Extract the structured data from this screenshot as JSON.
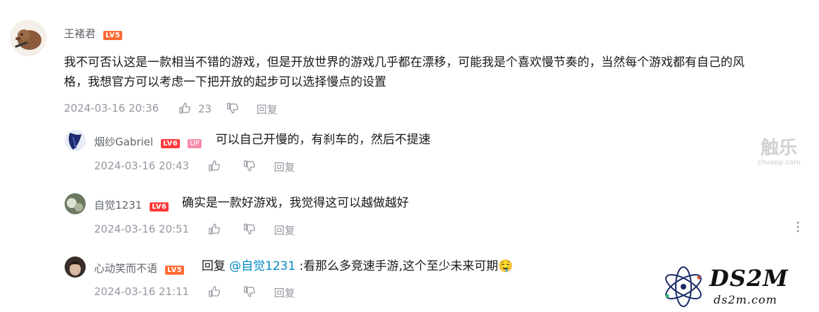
{
  "main_comment": {
    "username": "王褚君",
    "level": "LV5",
    "content": "我不可否认这是一款相当不错的游戏，但是开放世界的游戏几乎都在漂移，可能我是个喜欢慢节奏的，当然每个游戏都有自己的风格，我想官方可以考虑一下把开放的起步可以选择慢点的设置",
    "timestamp": "2024-03-16 20:36",
    "likes": "23",
    "reply_label": "回复"
  },
  "replies": [
    {
      "username": "烟纱Gabriel",
      "level": "LV6",
      "badge": "UP",
      "content": "可以自己开慢的，有刹车的，然后不提速",
      "timestamp": "2024-03-16 20:43",
      "reply_label": "回复"
    },
    {
      "username": "自觉1231",
      "level": "LV6",
      "content": "确实是一款好游戏，我觉得这可以越做越好",
      "timestamp": "2024-03-16 20:51",
      "reply_label": "回复"
    },
    {
      "username": "心动笑而不语",
      "level": "LV5",
      "reply_prefix": "回复",
      "mention": "@自觉1231",
      "content": ":看那么多竞速手游,这个至少未来可期",
      "emoji": "🤤",
      "timestamp": "2024-03-16 21:11",
      "reply_label": "回复"
    }
  ],
  "watermarks": {
    "chuapp_cn": "触乐",
    "chuapp_url": "chuapp.com",
    "ds2m_logo": "DS2M",
    "ds2m_url": "ds2m.com"
  },
  "icons": {
    "like": "thumbs-up-icon",
    "dislike": "thumbs-down-icon",
    "more": "more-vertical-icon"
  }
}
